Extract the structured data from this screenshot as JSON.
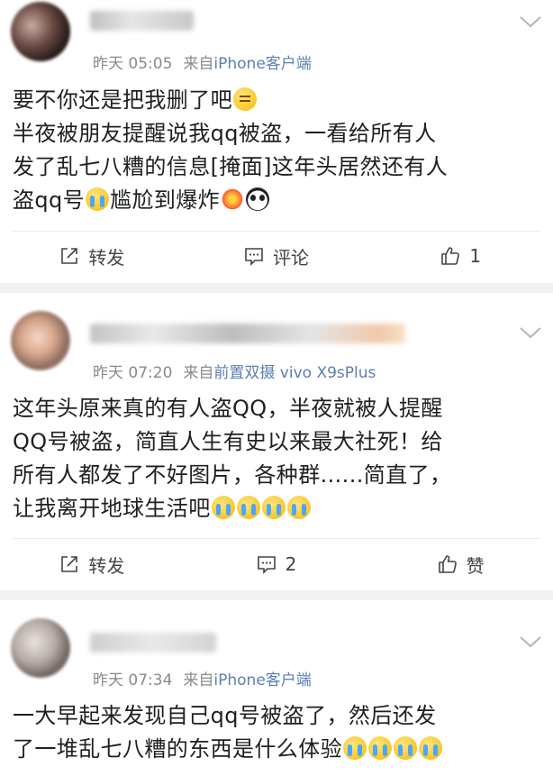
{
  "posts": [
    {
      "time": "昨天 05:05",
      "from_label": "来自",
      "source": "iPhone客户端",
      "lines": [
        "要不你还是把我删了吧",
        "半夜被朋友提醒说我qq被盗，一看给所有人",
        "发了乱七八糟的信息[掩面]这年头居然还有人",
        "盗qq号",
        "尴尬到爆炸"
      ],
      "repost_label": "转发",
      "comment_label": "评论",
      "like_label": "1"
    },
    {
      "time": "昨天 07:20",
      "from_label": "来自",
      "source": "前置双摄 vivo X9sPlus",
      "lines": [
        "这年头原来真的有人盗QQ，半夜就被人提醒",
        "QQ号被盗，简直人生有史以来最大社死！给",
        "所有人都发了不好图片，各种群......简直了，",
        "让我离开地球生活吧"
      ],
      "repost_label": "转发",
      "comment_label": "2",
      "like_label": "赞"
    },
    {
      "time": "昨天 07:34",
      "from_label": "来自",
      "source": "iPhone客户端",
      "lines": [
        "一大早起来发现自己qq号被盗了，然后还发",
        "了一堆乱七八糟的东西是什么体验"
      ]
    }
  ],
  "icons": {
    "repost": "repost-icon",
    "comment": "comment-icon",
    "like": "thumbs-up-icon",
    "chevron": "chevron-down-icon"
  },
  "colors": {
    "source_link": "#5b7fb0",
    "meta": "#8a8a8a",
    "separator": "#f2f2f2"
  }
}
